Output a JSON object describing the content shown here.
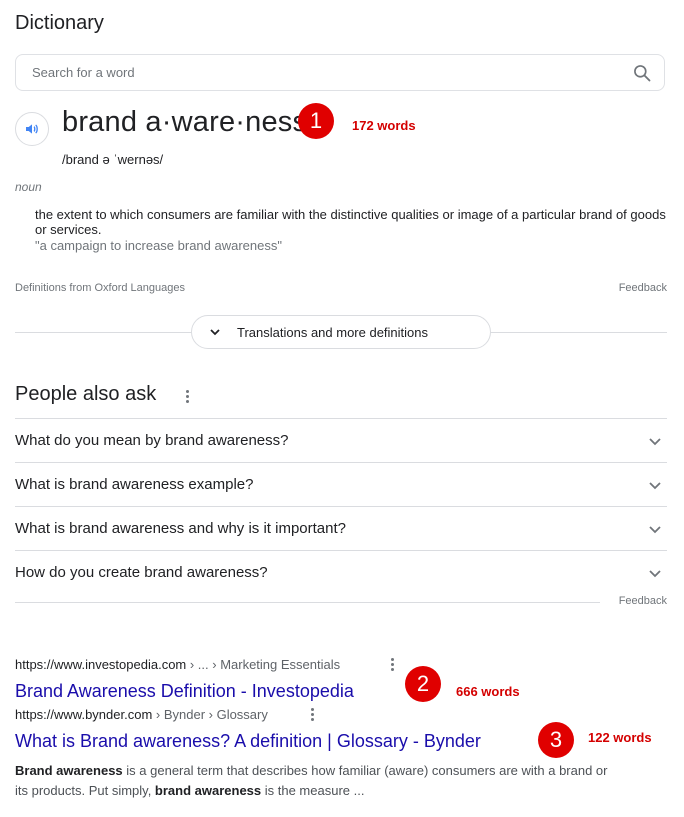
{
  "dictionary": {
    "title": "Dictionary",
    "search_placeholder": "Search for a word",
    "headword": "brand a·ware·ness",
    "annotation_1": {
      "number": "1",
      "words": "172 words"
    },
    "phonetic": "/brand ə ˈwernəs/",
    "part_of_speech": "noun",
    "definition": "the extent to which consumers are familiar with the distinctive qualities or image of a particular brand of goods or services.",
    "example": "\"a campaign to increase brand awareness\"",
    "source": "Definitions from Oxford Languages",
    "feedback": "Feedback",
    "translations_button": "Translations and more definitions"
  },
  "people_also_ask": {
    "title": "People also ask",
    "questions": [
      "What do you mean by brand awareness?",
      "What is brand awareness example?",
      "What is brand awareness and why is it important?",
      "How do you create brand awareness?"
    ],
    "feedback": "Feedback"
  },
  "results": [
    {
      "url_domain": "https://www.investopedia.com",
      "url_path": " › ... › Marketing Essentials",
      "title": "Brand Awareness Definition - Investopedia",
      "annotation": {
        "number": "2",
        "words": "666 words"
      }
    },
    {
      "url_domain": "https://www.bynder.com",
      "url_path": " › Bynder › Glossary",
      "title": "What is Brand awareness? A definition | Glossary - Bynder",
      "annotation": {
        "number": "3",
        "words": "122 words"
      },
      "snippet": {
        "b1": "Brand awareness",
        "t1": " is a general term that describes how familiar (aware) consumers are with a brand or its products. Put simply, ",
        "b2": "brand awareness",
        "t2": " is the measure ..."
      }
    }
  ],
  "colors": {
    "link": "#1a0dab",
    "badge": "#e00000",
    "annotation_text": "#d40000",
    "speaker": "#4285f4"
  }
}
